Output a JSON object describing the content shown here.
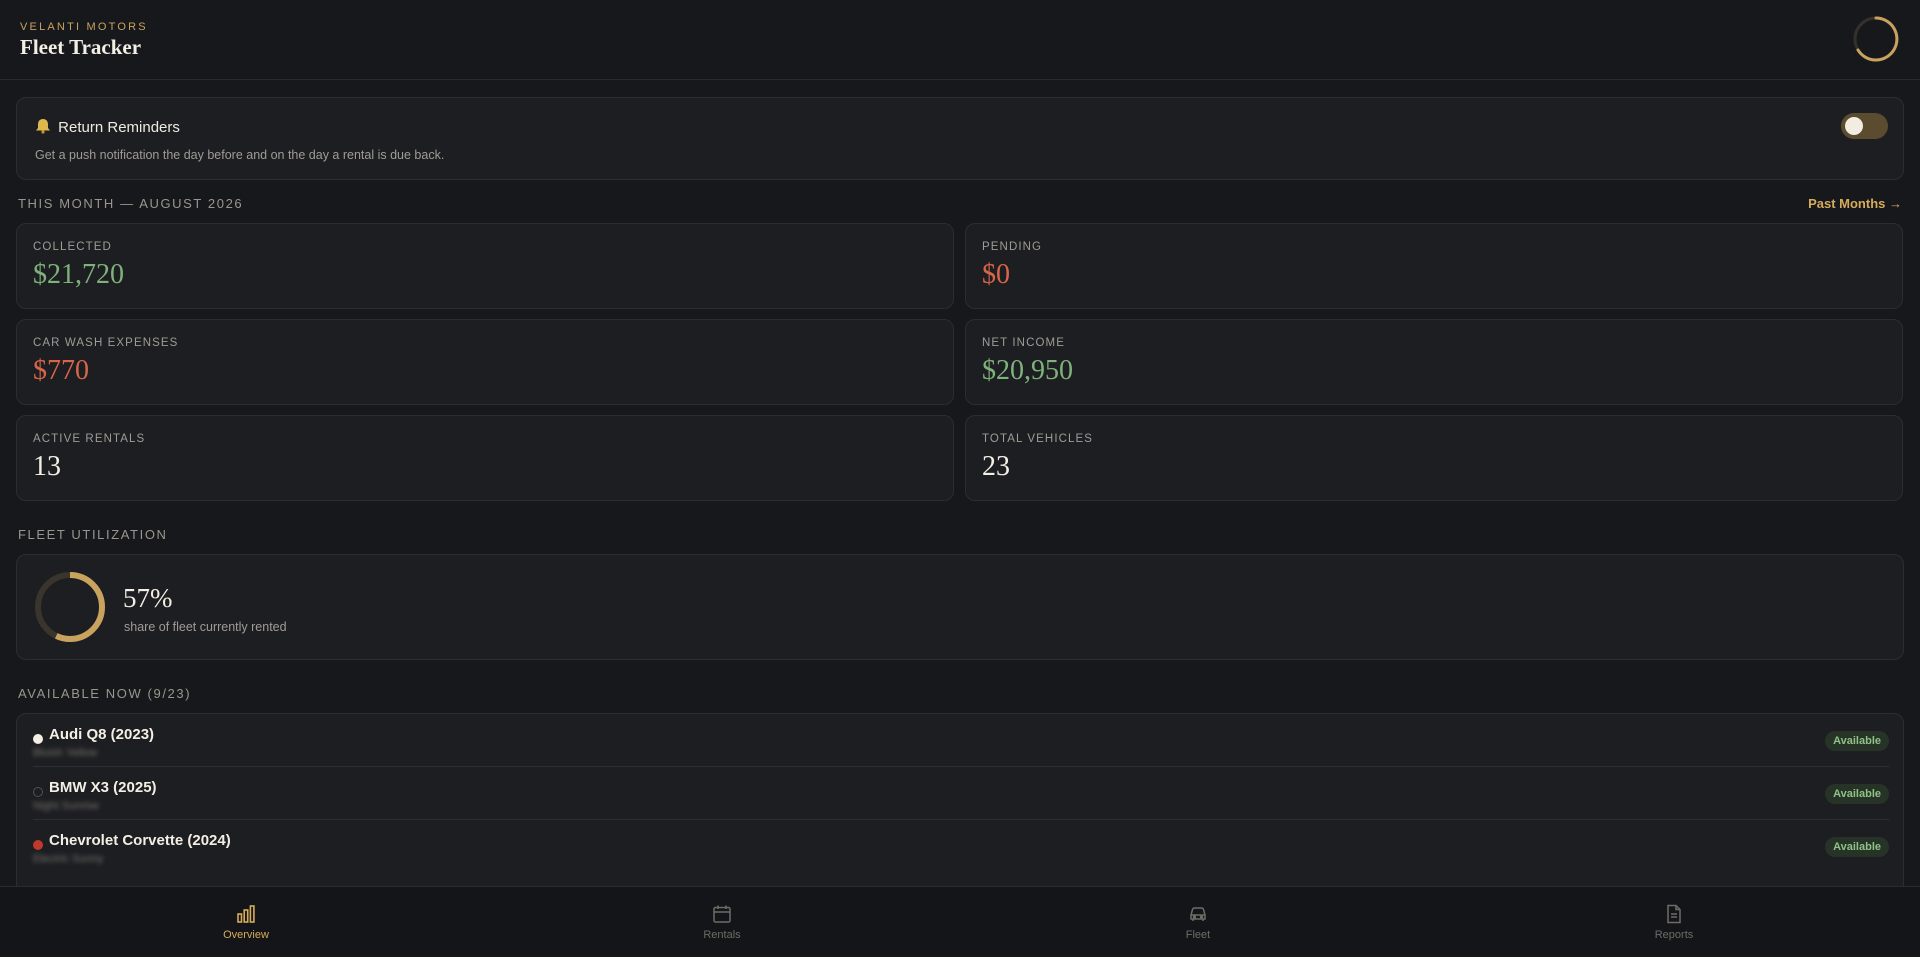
{
  "header": {
    "brand_sub": "VELANTI MOTORS",
    "title": "Fleet Tracker"
  },
  "reminder": {
    "icon": "bell-icon",
    "title": "Return Reminders",
    "description": "Get a push notification the day before and on the day a rental is due back.",
    "enabled": false
  },
  "month": {
    "label": "THIS MONTH — AUGUST 2026",
    "past_link": "Past Months →"
  },
  "stats": {
    "collected": {
      "label": "COLLECTED",
      "value": "$21,720"
    },
    "pending": {
      "label": "PENDING",
      "value": "$0"
    },
    "car_wash": {
      "label": "CAR WASH EXPENSES",
      "value": "$770"
    },
    "net_income": {
      "label": "NET INCOME",
      "value": "$20,950"
    },
    "active_rentals": {
      "label": "ACTIVE RENTALS",
      "value": "13"
    },
    "total_vehicles": {
      "label": "TOTAL VEHICLES",
      "value": "23"
    }
  },
  "utilization": {
    "section_label": "FLEET UTILIZATION",
    "percent_text": "57%",
    "fraction": 0.57,
    "subtitle": "share of fleet currently rented"
  },
  "available": {
    "section_label": "AVAILABLE NOW (9/23)",
    "vehicles": [
      {
        "name": "Audi Q8 (2023)",
        "plate": "Bluish Yellow",
        "status": "Available",
        "dot_color": "#f4efe4"
      },
      {
        "name": "BMW X3 (2025)",
        "plate": "Night Sunrise",
        "status": "Available",
        "dot_color": "#1d1e22"
      },
      {
        "name": "Chevrolet Corvette (2024)",
        "plate": "Electric Sunny",
        "status": "Available",
        "dot_color": "#c0392b"
      }
    ]
  },
  "nav": {
    "items": [
      {
        "label": "Overview",
        "icon": "bar-chart-icon",
        "active": true
      },
      {
        "label": "Rentals",
        "icon": "calendar-icon",
        "active": false
      },
      {
        "label": "Fleet",
        "icon": "car-icon",
        "active": false
      },
      {
        "label": "Reports",
        "icon": "document-icon",
        "active": false
      }
    ]
  },
  "colors": {
    "accent": "#d6ab5c",
    "positive": "#7fb27a",
    "negative": "#d8654a",
    "background": "#17181b"
  }
}
